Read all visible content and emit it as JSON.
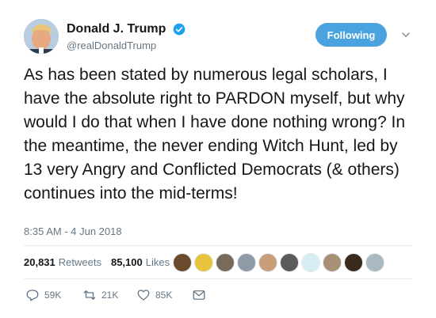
{
  "user": {
    "display_name": "Donald J. Trump",
    "handle": "@realDonaldTrump",
    "verified": true
  },
  "follow_button_label": "Following",
  "tweet_text": "As has been stated by numerous legal scholars, I have the absolute right to PARDON myself, but why would I do that when I have done nothing wrong? In the meantime, the never ending Witch Hunt, led by 13 very Angry and Conflicted Democrats (& others) continues into the mid-terms!",
  "timestamp": "8:35 AM - 4 Jun 2018",
  "stats": {
    "retweets_count": "20,831",
    "retweets_label": "Retweets",
    "likes_count": "85,100",
    "likes_label": "Likes"
  },
  "actions": {
    "reply_count": "59K",
    "retweet_count": "21K",
    "like_count": "85K"
  },
  "colors": {
    "accent": "#4aa3df",
    "muted": "#657786",
    "text": "#14171a",
    "divider": "#e6ecf0"
  },
  "icons": [
    "verified-badge-icon",
    "chevron-down-icon",
    "reply-icon",
    "retweet-icon",
    "like-icon",
    "message-icon"
  ]
}
